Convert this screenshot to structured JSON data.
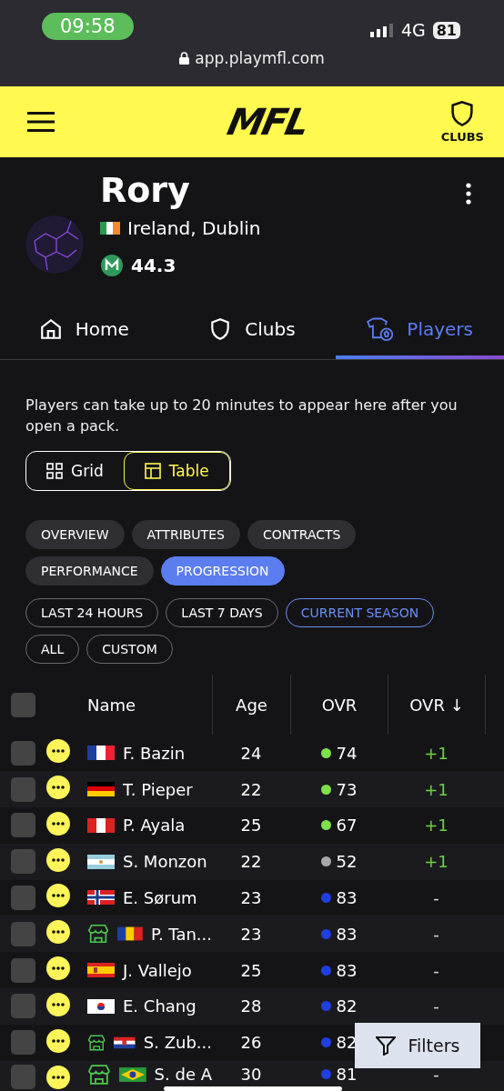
{
  "status_bar": {
    "time": "09:58",
    "network": "4G",
    "battery": "81"
  },
  "browser": {
    "url": "app.playmfl.com"
  },
  "header": {
    "logo": "MFL",
    "clubs_label": "CLUBS"
  },
  "profile": {
    "name": "Rory",
    "location": "Ireland, Dublin",
    "balance": "44.3"
  },
  "tabs": [
    {
      "label": "Home",
      "selected": false
    },
    {
      "label": "Clubs",
      "selected": false
    },
    {
      "label": "Players",
      "selected": true
    }
  ],
  "notice": "Players can take up to 20 minutes to appear here after you open a pack.",
  "view_toggle": [
    {
      "label": "Grid",
      "selected": false
    },
    {
      "label": "Table",
      "selected": true
    }
  ],
  "view_chips": [
    {
      "label": "OVERVIEW",
      "selected": false
    },
    {
      "label": "ATTRIBUTES",
      "selected": false
    },
    {
      "label": "CONTRACTS",
      "selected": false
    },
    {
      "label": "PERFORMANCE",
      "selected": false
    },
    {
      "label": "PROGRESSION",
      "selected": true
    }
  ],
  "period_chips": [
    {
      "label": "LAST 24 HOURS",
      "selected": false
    },
    {
      "label": "LAST 7 DAYS",
      "selected": false
    },
    {
      "label": "CURRENT SEASON",
      "selected": true
    },
    {
      "label": "ALL",
      "selected": false
    },
    {
      "label": "CUSTOM",
      "selected": false
    }
  ],
  "table": {
    "select_all": {
      "checked": false
    },
    "columns": [
      "Name",
      "Age",
      "OVR",
      "OVR ↓"
    ],
    "rows": [
      {
        "checked": false,
        "on_market": false,
        "name": "F. Bazin",
        "age": "24",
        "ovr": "74",
        "color": "#7ee04a",
        "change": "+1"
      },
      {
        "checked": false,
        "on_market": false,
        "name": "T. Pieper",
        "age": "22",
        "ovr": "73",
        "color": "#7ee04a",
        "change": "+1"
      },
      {
        "checked": false,
        "on_market": false,
        "name": "P. Ayala",
        "age": "25",
        "ovr": "67",
        "color": "#7ee04a",
        "change": "+1"
      },
      {
        "checked": false,
        "on_market": false,
        "name": "S. Monzon",
        "age": "22",
        "ovr": "52",
        "color": "#a8a8a8",
        "change": "+1"
      },
      {
        "checked": false,
        "on_market": false,
        "name": "E. Sørum",
        "age": "23",
        "ovr": "83",
        "color": "#1f3fe0",
        "change": "-"
      },
      {
        "checked": false,
        "on_market": true,
        "name": "P. Tan...",
        "age": "23",
        "ovr": "83",
        "color": "#1f3fe0",
        "change": "-"
      },
      {
        "checked": false,
        "on_market": false,
        "name": "J. Vallejo",
        "age": "25",
        "ovr": "83",
        "color": "#1f3fe0",
        "change": "-"
      },
      {
        "checked": false,
        "on_market": false,
        "name": "E. Chang",
        "age": "28",
        "ovr": "82",
        "color": "#1f3fe0",
        "change": "-"
      },
      {
        "checked": false,
        "on_market": true,
        "name": "S. Zub...",
        "age": "26",
        "ovr": "82",
        "color": "#1f3fe0"
      },
      {
        "checked": false,
        "on_market": true,
        "name": "S. de A",
        "age": "30",
        "ovr": "81",
        "color": "#1f3fe0",
        "change": "-"
      }
    ]
  },
  "filters_button": "Filters"
}
